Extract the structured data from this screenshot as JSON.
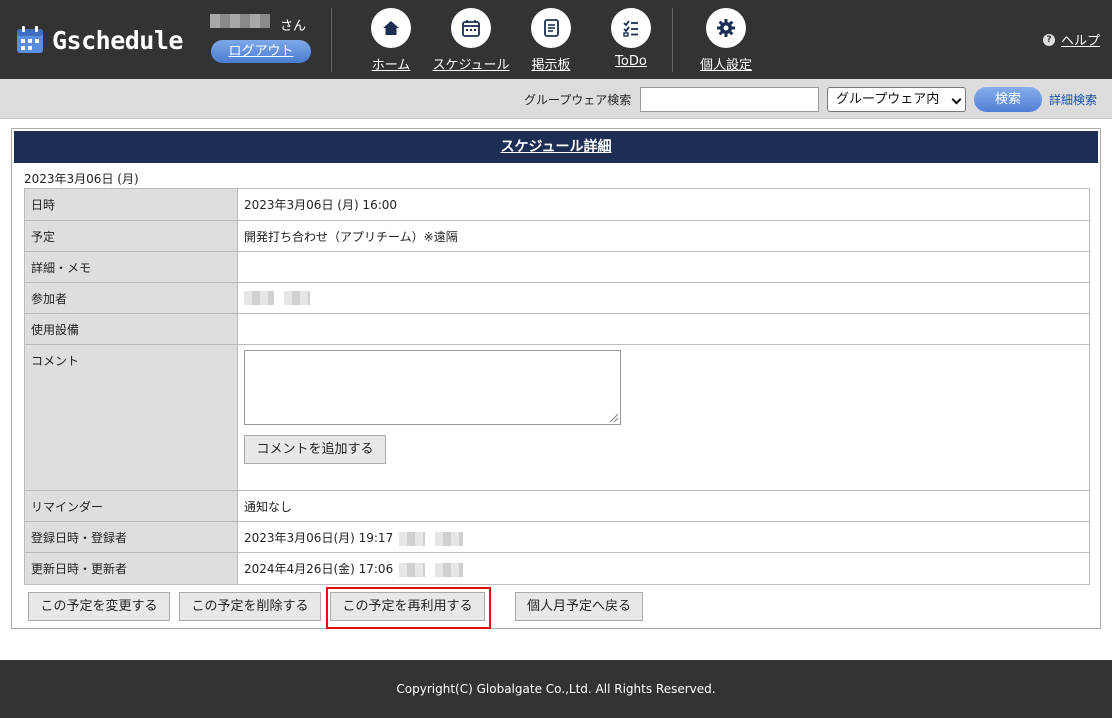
{
  "header": {
    "app_name": "Gschedule",
    "user_suffix": "さん",
    "logout_label": "ログアウト",
    "nav": [
      {
        "label": "ホーム",
        "icon": "home-icon"
      },
      {
        "label": "スケジュール",
        "icon": "calendar-icon"
      },
      {
        "label": "掲示板",
        "icon": "bulletin-board-icon"
      },
      {
        "label": "ToDo",
        "icon": "todo-list-icon"
      },
      {
        "label": "個人設定",
        "icon": "gear-icon"
      }
    ],
    "help_label": "ヘルプ",
    "help_glyph": "?"
  },
  "search": {
    "label": "グループウェア検索",
    "value": "",
    "scope_selected": "グループウェア内",
    "button_label": "検索",
    "detail_link": "詳細検索"
  },
  "detail": {
    "title": "スケジュール詳細",
    "date_caption": "2023年3月06日 (月)",
    "rows": {
      "datetime": {
        "label": "日時",
        "value": "2023年3月06日 (月) 16:00"
      },
      "plan": {
        "label": "予定",
        "value": "開発打ち合わせ（アプリチーム）※遠隔"
      },
      "memo": {
        "label": "詳細・メモ",
        "value": ""
      },
      "participants": {
        "label": "参加者"
      },
      "facilities": {
        "label": "使用設備",
        "value": ""
      },
      "comment": {
        "label": "コメント",
        "value": "",
        "add_button": "コメントを追加する"
      },
      "reminder": {
        "label": "リマインダー",
        "value": "通知なし"
      },
      "registered": {
        "label": "登録日時・登録者",
        "value": "2023年3月06日(月) 19:17"
      },
      "updated": {
        "label": "更新日時・更新者",
        "value": "2024年4月26日(金) 17:06"
      }
    }
  },
  "actions": {
    "edit": "この予定を変更する",
    "delete": "この予定を削除する",
    "reuse": "この予定を再利用する",
    "back": "個人月予定へ戻る"
  },
  "footer": {
    "copyright": "Copyright(C) Globalgate Co.,Ltd. All Rights Reserved."
  },
  "colors": {
    "header_bg": "#333333",
    "title_bar": "#1c2e54",
    "accent_blue": "#4f80d4",
    "highlight": "#e01010"
  }
}
